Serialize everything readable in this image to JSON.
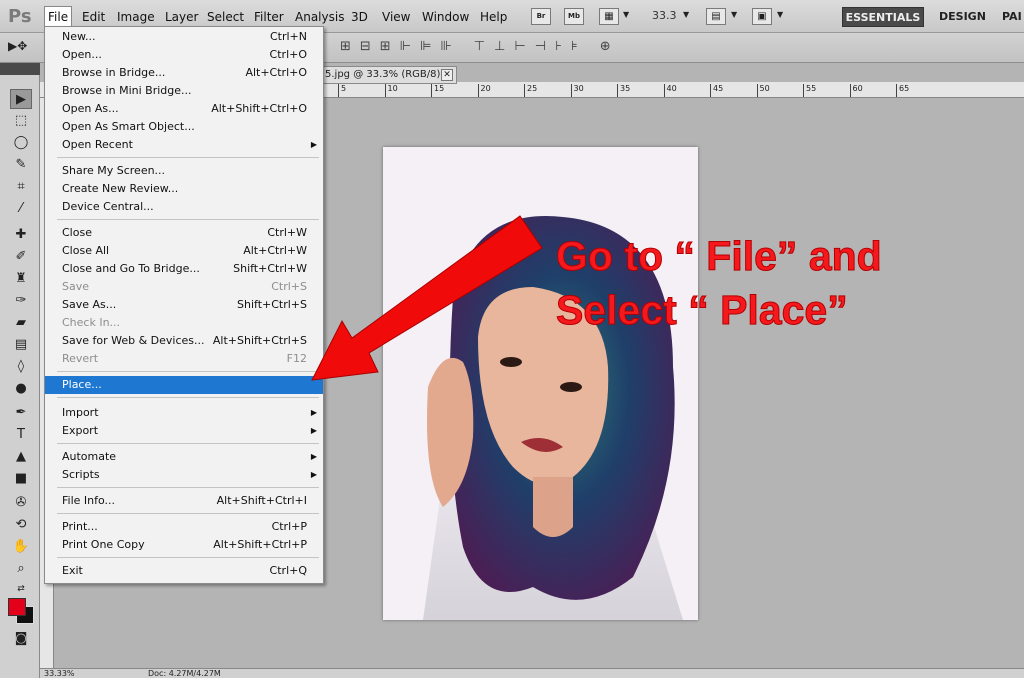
{
  "menubar": {
    "logo": "Ps",
    "items": [
      "File",
      "Edit",
      "Image",
      "Layer",
      "Select",
      "Filter",
      "Analysis",
      "3D",
      "View",
      "Window",
      "Help"
    ],
    "bridge_btn": "Br",
    "minibridge_btn": "Mb",
    "zoom": "33.3",
    "workspace_active": "ESSENTIALS",
    "workspace_design": "DESIGN",
    "workspace_paint": "PAI"
  },
  "document": {
    "tab_title": "5.jpg @ 33.3% (RGB/8)",
    "close": "✕",
    "ruler_ticks": [
      "5",
      "10",
      "15",
      "20",
      "25",
      "30",
      "35",
      "40",
      "45",
      "50",
      "55",
      "60",
      "65"
    ]
  },
  "status": {
    "zoom": "33.33%",
    "doc": "Doc: 4.27M/4.27M"
  },
  "file_menu": {
    "items": [
      {
        "label": "New...",
        "shortcut": "Ctrl+N"
      },
      {
        "label": "Open...",
        "shortcut": "Ctrl+O"
      },
      {
        "label": "Browse in Bridge...",
        "shortcut": "Alt+Ctrl+O"
      },
      {
        "label": "Browse in Mini Bridge...",
        "shortcut": ""
      },
      {
        "label": "Open As...",
        "shortcut": "Alt+Shift+Ctrl+O"
      },
      {
        "label": "Open As Smart Object...",
        "shortcut": ""
      },
      {
        "label": "Open Recent",
        "shortcut": ""
      },
      {
        "label": "Share My Screen...",
        "shortcut": ""
      },
      {
        "label": "Create New Review...",
        "shortcut": ""
      },
      {
        "label": "Device Central...",
        "shortcut": ""
      },
      {
        "label": "Close",
        "shortcut": "Ctrl+W"
      },
      {
        "label": "Close All",
        "shortcut": "Alt+Ctrl+W"
      },
      {
        "label": "Close and Go To Bridge...",
        "shortcut": "Shift+Ctrl+W"
      },
      {
        "label": "Save",
        "shortcut": "Ctrl+S"
      },
      {
        "label": "Save As...",
        "shortcut": "Shift+Ctrl+S"
      },
      {
        "label": "Check In...",
        "shortcut": ""
      },
      {
        "label": "Save for Web & Devices...",
        "shortcut": "Alt+Shift+Ctrl+S"
      },
      {
        "label": "Revert",
        "shortcut": "F12"
      },
      {
        "label": "Place...",
        "shortcut": ""
      },
      {
        "label": "Import",
        "shortcut": ""
      },
      {
        "label": "Export",
        "shortcut": ""
      },
      {
        "label": "Automate",
        "shortcut": ""
      },
      {
        "label": "Scripts",
        "shortcut": ""
      },
      {
        "label": "File Info...",
        "shortcut": "Alt+Shift+Ctrl+I"
      },
      {
        "label": "Print...",
        "shortcut": "Ctrl+P"
      },
      {
        "label": "Print One Copy",
        "shortcut": "Alt+Shift+Ctrl+P"
      },
      {
        "label": "Exit",
        "shortcut": "Ctrl+Q"
      }
    ]
  },
  "annotation": {
    "line1": "Go to “ File” and",
    "line2": "Select “ Place”",
    "color": "#f5191e"
  },
  "colors": {
    "foreground": "#e3001b",
    "background": "#111111",
    "menu_highlight": "#1e78d2"
  }
}
